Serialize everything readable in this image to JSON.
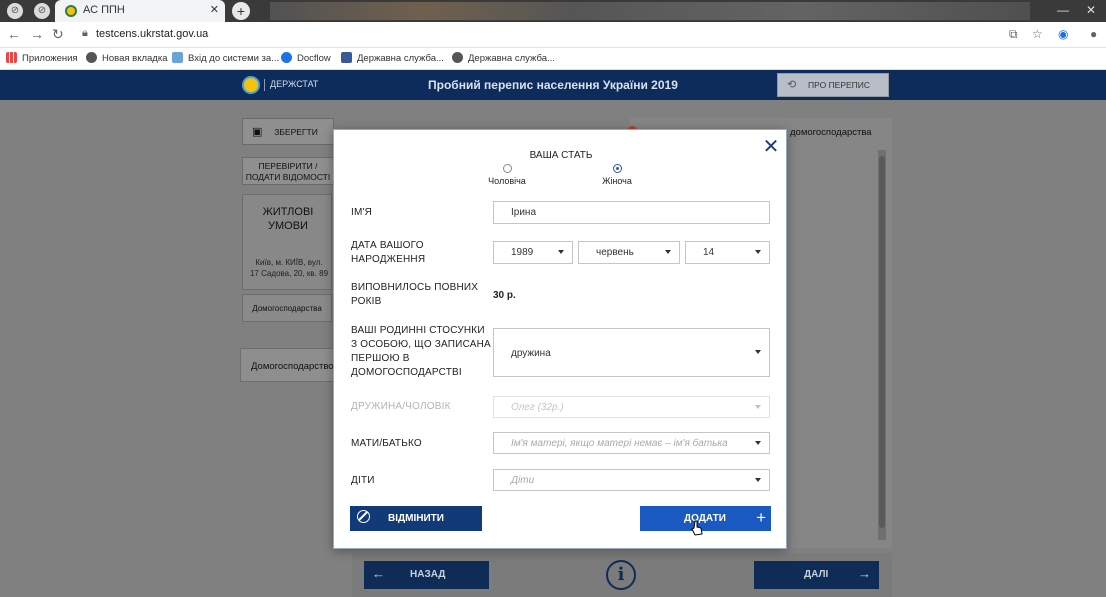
{
  "browser": {
    "tab_title": "АС ППН",
    "url": "testcens.ukrstat.gov.ua",
    "bookmarks": [
      "Приложения",
      "Новая вкладка",
      "Вхід до системи за...",
      "Docflow",
      "Державна служба...",
      "Державна служба..."
    ]
  },
  "site": {
    "brand": "ДЕРЖСТАТ",
    "title": "Пробний перепис населення України 2019",
    "about_button": "ПРО ПЕРЕПИС"
  },
  "sidebar": {
    "save": "ЗБЕРЕГТИ",
    "check_line1": "ПЕРЕВІРИТИ /",
    "check_line2": "ПОДАТИ ВІДОМОСТІ",
    "card_title_line1": "ЖИТЛОВІ",
    "card_title_line2": "УМОВИ",
    "card_addr_line1": "Київ, м. КИЇВ, вул.",
    "card_addr_line2": "17 Садова, 20, кв. 89",
    "household_tab": "Домогосподарства",
    "household_item": "Домогосподарство"
  },
  "right_panel": {
    "header": "домогосподарства"
  },
  "bottom": {
    "back": "НАЗАД",
    "next": "ДАЛІ",
    "info": "i"
  },
  "modal": {
    "gender_title": "ВАША СТАТЬ",
    "gender_options": [
      {
        "label": "Чоловіча",
        "selected": false
      },
      {
        "label": "Жіноча",
        "selected": true
      }
    ],
    "name_label": "ІМ'Я",
    "name_value": "Ірина",
    "dob_label_line1": "ДАТА ВАШОГО",
    "dob_label_line2": "НАРОДЖЕННЯ",
    "dob_year": "1989",
    "dob_month": "червень",
    "dob_day": "14",
    "age_label_line1": "ВИПОВНИЛОСЬ ПОВНИХ",
    "age_label_line2": "РОКІВ",
    "age_value": "30 р.",
    "relation_label_line1": "ВАШІ РОДИННІ СТОСУНКИ",
    "relation_label_line2": "З ОСОБОЮ, ЩО ЗАПИСАНА",
    "relation_label_line3": "ПЕРШОЮ В",
    "relation_label_line4": "ДОМОГОСПОДАРСТВІ",
    "relation_value": "дружина",
    "spouse_label": "ДРУЖИНА/ЧОЛОВІК",
    "spouse_placeholder": "Олег (32р.)",
    "parent_label": "МАТИ/БАТЬКО",
    "parent_placeholder": "Ім'я матері, якщо матері немає – ім'я батька",
    "children_label": "ДІТИ",
    "children_placeholder": "Діти",
    "cancel_button": "ВІДМІНИТИ",
    "add_button": "ДОДАТИ"
  },
  "colors": {
    "header_bg": "#0d2c5c",
    "primary_button": "#1a58c2",
    "cancel_button": "#123a78",
    "overlay": "#808080"
  }
}
